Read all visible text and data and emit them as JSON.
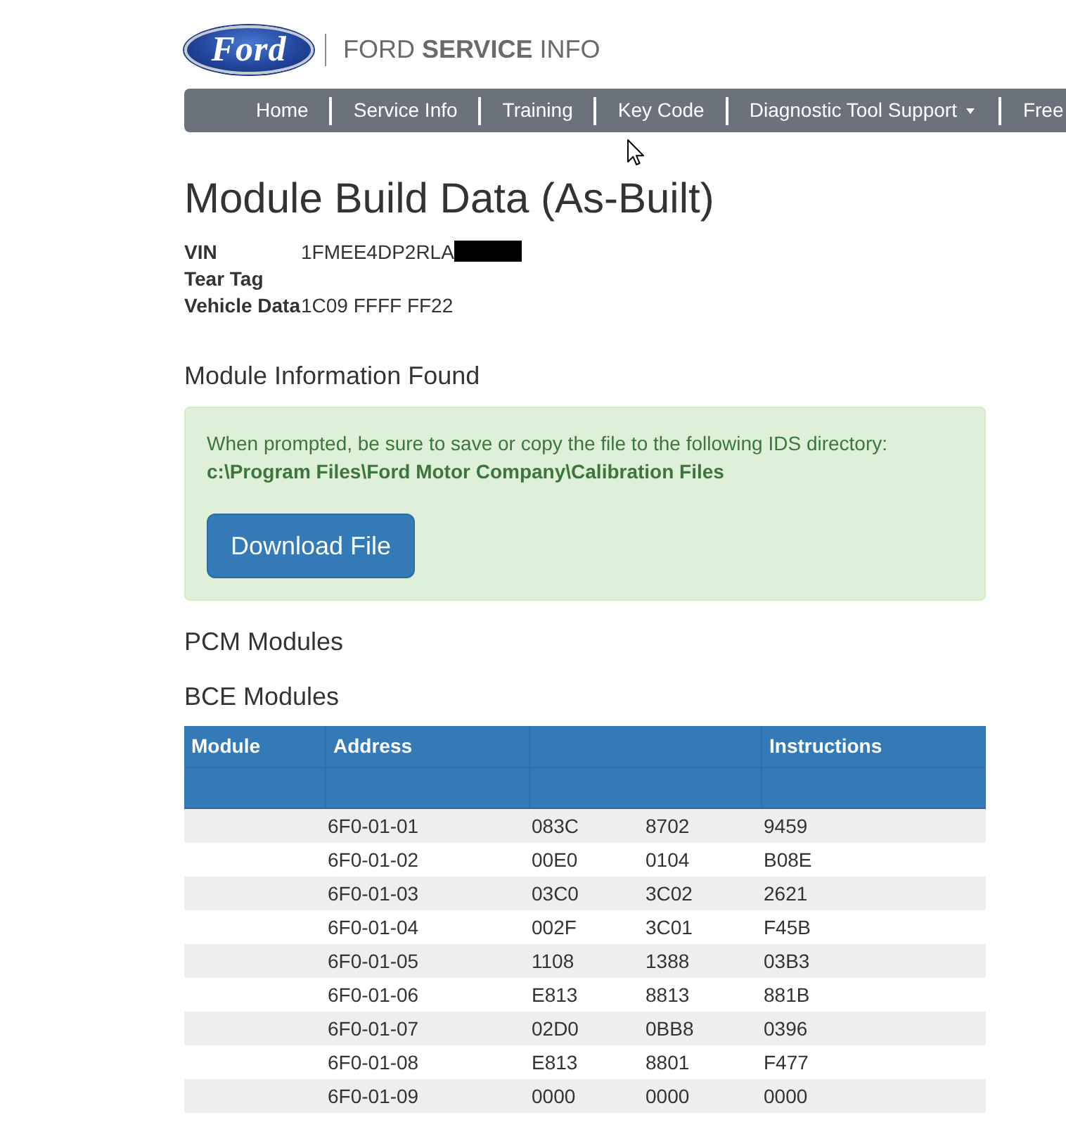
{
  "header": {
    "logo_text": "Ford",
    "brand": "FORD **SERVICE** INFO"
  },
  "nav": {
    "items": [
      {
        "label": "Home",
        "dropdown": false
      },
      {
        "label": "Service Info",
        "dropdown": false
      },
      {
        "label": "Training",
        "dropdown": false
      },
      {
        "label": "Key Code",
        "dropdown": false
      },
      {
        "label": "Diagnostic Tool Support",
        "dropdown": true
      },
      {
        "label": "Free",
        "dropdown": false
      }
    ]
  },
  "page_title": "Module Build Data (As-Built)",
  "vehicle_info": [
    {
      "label": "VIN",
      "value": "1FMEE4DP2RLA",
      "redacted": true
    },
    {
      "label": "Tear Tag",
      "redacted": false
    },
    {
      "label": "Vehicle Data",
      "value": "1C09 FFFF FF22",
      "redacted": false
    }
  ],
  "module_info": {
    "heading": "Module Information Found",
    "alert": {
      "message": "When prompted, be sure to save or copy the file to the following IDS directory:",
      "path": "c:\\Program Files\\Ford Motor Company\\Calibration Files",
      "button": "Download File"
    }
  },
  "sections": [
    {
      "heading": "PCM Modules"
    },
    {
      "heading": "BCE Modules",
      "table": {
        "columns": [
          {
            "kind": "label",
            "label": "Module"
          },
          {
            "kind": "label",
            "label": "Address"
          },
          {
            "kind": "blank"
          },
          {
            "kind": "label",
            "label": "Instructions"
          }
        ],
        "rows": [
          {
            "address": "6F0-01-01",
            "values": [
              "083C",
              "8702"
            ],
            "instructions": "9459"
          },
          {
            "address": "6F0-01-02",
            "values": [
              "00E0",
              "0104"
            ],
            "instructions": "B08E"
          },
          {
            "address": "6F0-01-03",
            "values": [
              "03C0",
              "3C02"
            ],
            "instructions": "2621"
          },
          {
            "address": "6F0-01-04",
            "values": [
              "002F",
              "3C01"
            ],
            "instructions": "F45B"
          },
          {
            "address": "6F0-01-05",
            "values": [
              "1108",
              "1388"
            ],
            "instructions": "03B3"
          },
          {
            "address": "6F0-01-06",
            "values": [
              "E813",
              "8813"
            ],
            "instructions": "881B"
          },
          {
            "address": "6F0-01-07",
            "values": [
              "02D0",
              "0BB8"
            ],
            "instructions": "0396"
          },
          {
            "address": "6F0-01-08",
            "values": [
              "E813",
              "8801"
            ],
            "instructions": "F477"
          },
          {
            "address": "6F0-01-09",
            "values": [
              "0000",
              "0000"
            ],
            "instructions": "0000"
          }
        ]
      }
    }
  ]
}
